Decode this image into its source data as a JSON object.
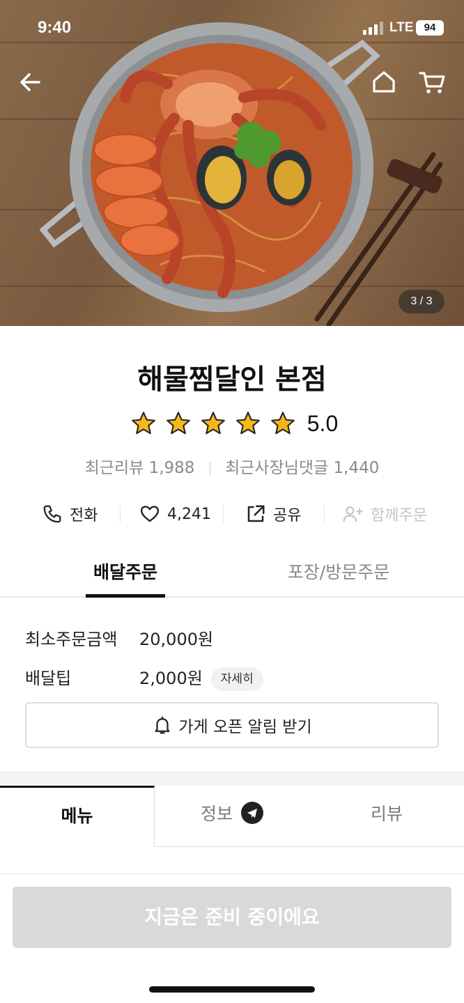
{
  "status_bar": {
    "time": "9:40",
    "network": "LTE",
    "battery": "94"
  },
  "hero": {
    "page_indicator": "3 / 3"
  },
  "store": {
    "name": "해물찜달인 본점",
    "rating": "5.0",
    "rating_stars": 5,
    "recent_reviews_label": "최근리뷰",
    "recent_reviews_count": "1,988",
    "owner_replies_label": "최근사장님댓글",
    "owner_replies_count": "1,440"
  },
  "actions": {
    "call_label": "전화",
    "like_count": "4,241",
    "share_label": "공유",
    "group_order_label": "함께주문"
  },
  "order_tabs": [
    {
      "label": "배달주문",
      "active": true
    },
    {
      "label": "포장/방문주문",
      "active": false
    }
  ],
  "order_info": {
    "min_order_label": "최소주문금액",
    "min_order_value": "20,000원",
    "delivery_tip_label": "배달팁",
    "delivery_tip_value": "2,000원",
    "detail_chip": "자세히"
  },
  "notify_button": "가게 오픈 알림 받기",
  "main_tabs": [
    {
      "label": "메뉴",
      "active": true
    },
    {
      "label": "정보",
      "active": false,
      "icon": "telegram-icon"
    },
    {
      "label": "리뷰",
      "active": false
    }
  ],
  "cta": "지금은 준비 중이에요",
  "colors": {
    "star": "#F6B819",
    "cta_disabled": "#D9D9D9",
    "text_muted": "#8A8A8A"
  }
}
